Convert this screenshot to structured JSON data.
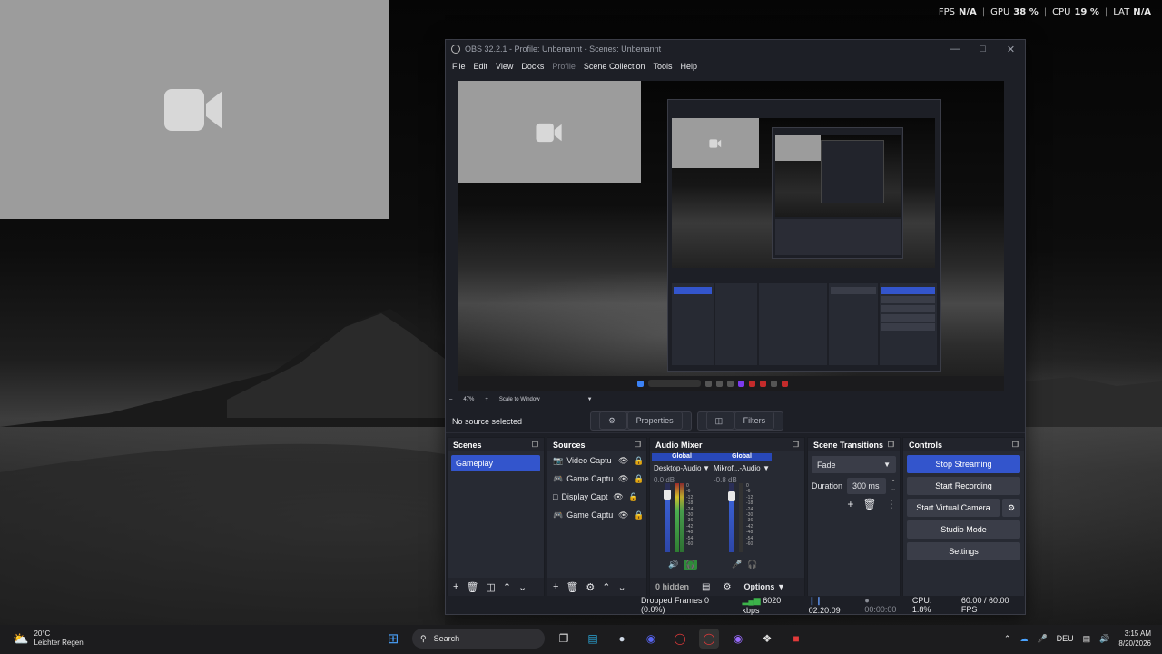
{
  "desktop_stats": {
    "fps_label": "FPS",
    "fps_value": "N/A",
    "gpu_label": "GPU",
    "gpu_value": "38",
    "gpu_unit": "%",
    "cpu_label": "CPU",
    "cpu_value": "19",
    "cpu_unit": "%",
    "lat_label": "LAT",
    "lat_value": "N/A"
  },
  "obs": {
    "title": "OBS 32.2.1 - Profile: Unbenannt - Scenes: Unbenannt",
    "menu": [
      "File",
      "Edit",
      "View",
      "Docks",
      "Profile",
      "Scene Collection",
      "Tools",
      "Help"
    ],
    "zoom": "47%",
    "scale_mode": "Scale to Window",
    "no_source": "No source selected",
    "properties_btn": "Properties",
    "filters_btn": "Filters",
    "scenes": {
      "title": "Scenes",
      "items": [
        "Gameplay"
      ]
    },
    "sources": {
      "title": "Sources",
      "items": [
        "Video Captu",
        "Game Captu",
        "Display Capt",
        "Game Captu"
      ]
    },
    "audio_mixer": {
      "title": "Audio Mixer",
      "channels": [
        {
          "global": "Global",
          "name": "Desktop-Audio",
          "db": "0.0 dB"
        },
        {
          "global": "Global",
          "name": "Mikrof...-Audio",
          "db": "-0.8 dB"
        }
      ],
      "ticks": [
        "0",
        "-6",
        "-12",
        "-18",
        "-24",
        "-30",
        "-36",
        "-42",
        "-48",
        "-54",
        "-60"
      ],
      "hidden": "0 hidden",
      "options": "Options"
    },
    "transitions": {
      "title": "Scene Transitions",
      "selected": "Fade",
      "duration_label": "Duration",
      "duration_value": "300 ms"
    },
    "controls": {
      "title": "Controls",
      "stop_streaming": "Stop Streaming",
      "start_recording": "Start Recording",
      "start_virtual_camera": "Start Virtual Camera",
      "studio_mode": "Studio Mode",
      "settings": "Settings"
    },
    "status": {
      "dropped": "Dropped Frames 0 (0.0%)",
      "bitrate": "6020 kbps",
      "stream_time": "02:20:09",
      "rec_time": "00:00:00",
      "cpu": "CPU: 1.8%",
      "fps": "60.00 / 60.00 FPS"
    }
  },
  "taskbar": {
    "temp": "20°C",
    "weather": "Leichter Regen",
    "search": "Search",
    "lang": "DEU",
    "time": "3:15 AM",
    "date": "8/20/2026"
  },
  "colors": {
    "accent": "#3355cc",
    "bg": "#1d1f26",
    "dock": "#272a33"
  }
}
